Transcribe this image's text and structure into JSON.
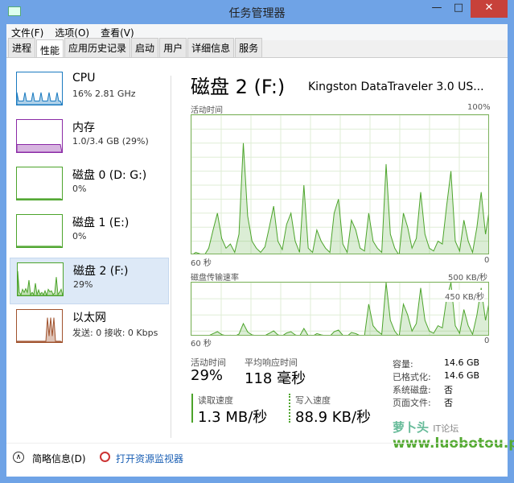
{
  "window": {
    "title": "任务管理器",
    "minimize": "—",
    "maximize": "□",
    "close": "✕"
  },
  "menu": [
    "文件(F)",
    "选项(O)",
    "查看(V)"
  ],
  "tabs": [
    {
      "label": "进程"
    },
    {
      "label": "性能",
      "active": true
    },
    {
      "label": "应用历史记录"
    },
    {
      "label": "启动"
    },
    {
      "label": "用户"
    },
    {
      "label": "详细信息"
    },
    {
      "label": "服务"
    }
  ],
  "sidebar": [
    {
      "name": "CPU",
      "sub": "16% 2.81 GHz",
      "color": "#1a7ac0"
    },
    {
      "name": "内存",
      "sub": "1.0/3.4 GB (29%)",
      "color": "#8b2aa6"
    },
    {
      "name": "磁盘 0 (D: G:)",
      "sub": "0%",
      "color": "#4ca42b"
    },
    {
      "name": "磁盘 1 (E:)",
      "sub": "0%",
      "color": "#4ca42b"
    },
    {
      "name": "磁盘 2 (F:)",
      "sub": "29%",
      "color": "#4ca42b",
      "selected": true
    },
    {
      "name": "以太网",
      "sub": "发送: 0 接收: 0 Kbps",
      "color": "#a0522d"
    }
  ],
  "main": {
    "title": "磁盘 2 (F:)",
    "device": "Kingston DataTraveler 3.0 US...",
    "g1": {
      "label": "活动时间",
      "max": "100%",
      "left": "60 秒",
      "right": "0"
    },
    "g2": {
      "label": "磁盘传输速率",
      "max": "500 KB/秒",
      "marker": "450 KB/秒",
      "left": "60 秒",
      "right": "0"
    },
    "active_label": "活动时间",
    "active": "29%",
    "resp_label": "平均响应时间",
    "resp": "118 毫秒",
    "read_label": "读取速度",
    "read": "1.3 MB/秒",
    "write_label": "写入速度",
    "write": "88.9 KB/秒",
    "props": [
      [
        "容量:",
        "14.6 GB"
      ],
      [
        "已格式化:",
        "14.6 GB"
      ],
      [
        "系统磁盘:",
        "否"
      ],
      [
        "页面文件:",
        "否"
      ]
    ]
  },
  "chart_data": {
    "type": "area",
    "xlabel": "60 秒",
    "ylim": [
      0,
      100
    ],
    "activity": [
      0,
      2,
      1,
      0,
      5,
      18,
      30,
      12,
      5,
      8,
      2,
      15,
      80,
      28,
      10,
      5,
      2,
      6,
      20,
      35,
      10,
      4,
      22,
      30,
      10,
      2,
      50,
      5,
      2,
      18,
      10,
      5,
      2,
      30,
      40,
      8,
      2,
      25,
      18,
      5,
      3,
      30,
      10,
      5,
      2,
      65,
      15,
      5,
      0,
      30,
      20,
      5,
      12,
      45,
      15,
      5,
      3,
      10,
      8,
      35,
      60,
      10,
      3,
      25,
      10,
      2,
      20,
      45,
      15,
      35
    ]
  },
  "bottom": {
    "less": "简略信息(D)",
    "monitor": "打开资源监视器"
  },
  "watermark": "萝卜头 IT论坛 www.luobotou.pw"
}
